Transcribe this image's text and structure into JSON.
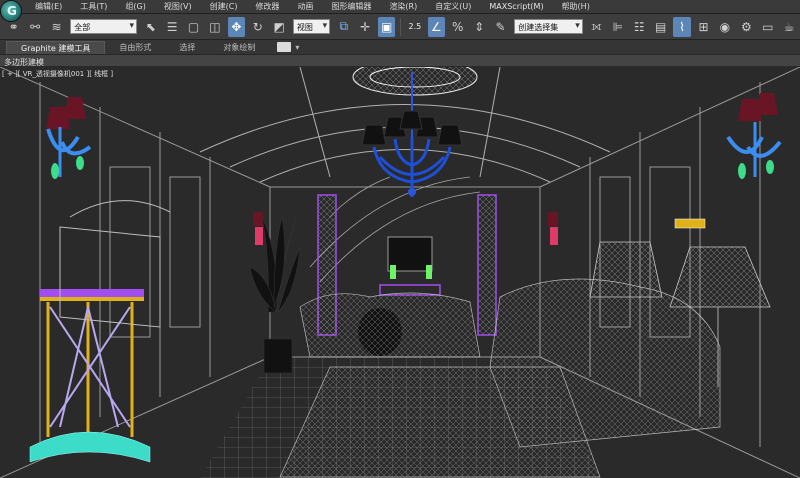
{
  "app": {
    "logo_letter": "G"
  },
  "menu": {
    "items": [
      "编辑(E)",
      "工具(T)",
      "组(G)",
      "视图(V)",
      "创建(C)",
      "修改器",
      "动画",
      "图形编辑器",
      "渲染(R)",
      "自定义(U)",
      "MAXScript(M)",
      "帮助(H)"
    ]
  },
  "toolbar": {
    "selection_filter": "全部",
    "reference_coord": "视图",
    "angle_snap_value": "2.5",
    "named_selection_placeholder": "创建选择集"
  },
  "ribbon": {
    "tabs": [
      "Graphite 建模工具",
      "自由形式",
      "选择",
      "对象绘制"
    ]
  },
  "subpanel": {
    "label": "多边形建模"
  },
  "viewport": {
    "label": "[ + ][ VR_透视摄像机001 ][ 线框 ]"
  },
  "colors": {
    "menubar": "#3a3a3a",
    "toolbar": "#3d3d3d",
    "active_tool": "#5c86b8",
    "viewport_bg": "#2a2a2a",
    "wire_gray": "#9a9a9a",
    "wire_purple": "#a24df0",
    "wire_blue": "#1f4fd6",
    "wire_yellow": "#e0b21a"
  }
}
